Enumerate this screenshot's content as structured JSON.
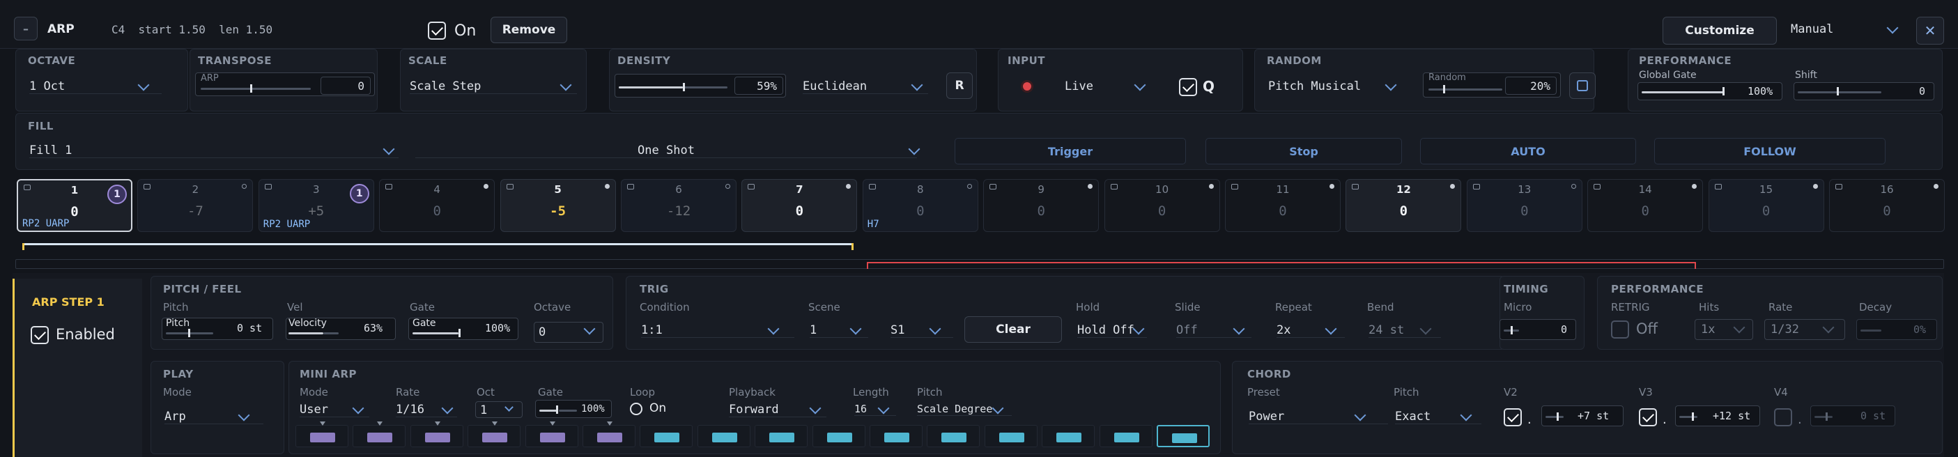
{
  "header": {
    "collapse": "–",
    "title": "ARP",
    "info": "C4  start 1.50  len 1.50",
    "on_label": "On",
    "remove": "Remove",
    "customize": "Customize",
    "mode": "Manual",
    "close": "✕"
  },
  "octave": {
    "label": "OCTAVE",
    "value": "1 Oct"
  },
  "transpose": {
    "label": "TRANSPOSE",
    "slider_label": "ARP",
    "value": "0",
    "level": 0.45
  },
  "scale": {
    "label": "SCALE",
    "value": "Scale Step"
  },
  "density": {
    "label": "DENSITY",
    "value": "59%",
    "level": 0.59,
    "mode": "Euclidean",
    "r_button": "R"
  },
  "input": {
    "label": "INPUT",
    "value": "Live",
    "q_label": "Q"
  },
  "random": {
    "label": "RANDOM",
    "value": "Pitch Musical",
    "slider_label": "Random",
    "amount": "20%",
    "level": 0.2
  },
  "performance_top": {
    "label": "PERFORMANCE",
    "gate_label": "Global Gate",
    "gate_value": "100%",
    "shift_label": "Shift",
    "shift_value": "0"
  },
  "fill": {
    "label": "FILL",
    "value": "Fill 1",
    "mode": "One Shot",
    "trigger": "Trigger",
    "stop": "Stop",
    "auto": "AUTO",
    "follow": "FOLLOW"
  },
  "steps": [
    {
      "n": "1",
      "v": "0",
      "tag": "RP2 UARP",
      "badge": "1"
    },
    {
      "n": "2",
      "v": "-7"
    },
    {
      "n": "3",
      "v": "+5",
      "tag": "RP2 UARP",
      "badge": "1"
    },
    {
      "n": "4",
      "v": "0"
    },
    {
      "n": "5",
      "v": "-5"
    },
    {
      "n": "6",
      "v": "-12"
    },
    {
      "n": "7",
      "v": "0"
    },
    {
      "n": "8",
      "v": "0",
      "tag": "H7"
    },
    {
      "n": "9",
      "v": "0"
    },
    {
      "n": "10",
      "v": "0"
    },
    {
      "n": "11",
      "v": "0"
    },
    {
      "n": "12",
      "v": "0"
    },
    {
      "n": "13",
      "v": "0"
    },
    {
      "n": "14",
      "v": "0"
    },
    {
      "n": "15",
      "v": "0"
    },
    {
      "n": "16",
      "v": "0"
    }
  ],
  "step_panel": {
    "title": "ARP STEP 1",
    "enabled": "Enabled"
  },
  "pitch_feel": {
    "label": "PITCH / FEEL",
    "pitch": "Pitch",
    "pitch_slider": "Pitch",
    "pitch_value": "0 st",
    "vel": "Vel",
    "vel_slider": "Velocity",
    "vel_value": "63%",
    "gate": "Gate",
    "gate_slider": "Gate",
    "gate_value": "100%",
    "octave": "Octave",
    "octave_value": "0"
  },
  "trig": {
    "label": "TRIG",
    "condition": "Condition",
    "condition_value": "1:1",
    "scene": "Scene",
    "scene_value": "1",
    "scene2_value": "S1",
    "clear": "Clear",
    "hold": "Hold",
    "hold_value": "Hold Off",
    "slide": "Slide",
    "slide_value": "Off",
    "repeat": "Repeat",
    "repeat_value": "2x",
    "bend": "Bend",
    "bend_value": "24 st"
  },
  "timing": {
    "label": "TIMING",
    "micro": "Micro",
    "micro_value": "0"
  },
  "perf": {
    "label": "PERFORMANCE",
    "retrig": "RETRIG",
    "retrig_value": "Off",
    "hits": "Hits",
    "hits_value": "1x",
    "rate": "Rate",
    "rate_value": "1/32",
    "decay": "Decay",
    "decay_value": "0%"
  },
  "play": {
    "label": "PLAY",
    "mode": "Mode",
    "mode_value": "Arp"
  },
  "mini_arp": {
    "label": "MINI ARP",
    "mode": "Mode",
    "mode_value": "User",
    "rate": "Rate",
    "rate_value": "1/16",
    "oct": "Oct",
    "oct_value": "1",
    "gate": "Gate",
    "gate_value": "100%",
    "loop": "Loop",
    "loop_value": "On",
    "playback": "Playback",
    "playback_value": "Forward",
    "length": "Length",
    "length_value": "16",
    "pitch": "Pitch",
    "pitch_value": "Scale Degree"
  },
  "chord": {
    "label": "CHORD",
    "preset": "Preset",
    "preset_value": "Power",
    "pitch": "Pitch",
    "pitch_value": "Exact",
    "v2": "V2",
    "v2_value": "+7 st",
    "v3": "V3",
    "v3_value": "+12 st",
    "v4": "V4",
    "v4_value": "0 st",
    "dot": "."
  },
  "colors": {
    "accent": "#6e9ad8",
    "purple": "#8c7cc0",
    "cyan": "#4fb6d0",
    "yellow": "#f2c94c",
    "red": "#e0474c"
  }
}
